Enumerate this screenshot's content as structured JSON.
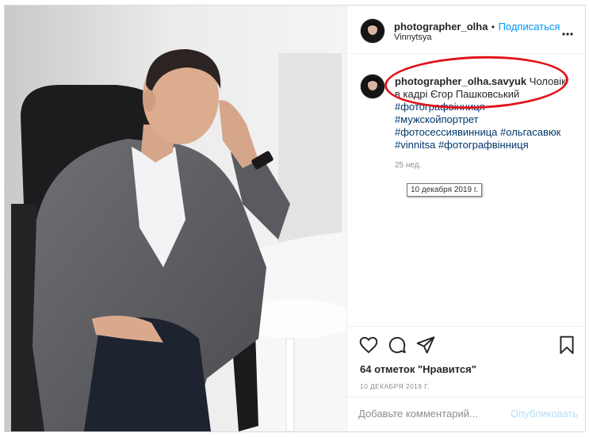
{
  "header": {
    "username": "photographer_olha",
    "separator": "•",
    "follow_label": "Подписаться",
    "location": "Vinnytsya",
    "more_label": "..."
  },
  "caption": {
    "username": "photographer_olha.savyuk",
    "text": "Чоловік в кадрі Єгор Пашковський",
    "hashtags": [
      "#фотографвінниця",
      "#мужскойпортрет",
      "#фотосессиявинница",
      "#ольгасавюк",
      "#vinnitsa",
      "#фотографвінниця"
    ],
    "age": "25 нед.",
    "tooltip": "10 декабря 2019 г."
  },
  "actions": {
    "likes": "64 отметок \"Нравится\"",
    "date": "10 ДЕКАБРЯ 2019 Г.",
    "comment_placeholder": "Добавьте комментарий...",
    "publish_label": "Опубликовать"
  },
  "colors": {
    "link": "#00376b",
    "follow": "#0095f6",
    "annotation": "#e0141a",
    "publish_disabled": "#b2dffc"
  }
}
